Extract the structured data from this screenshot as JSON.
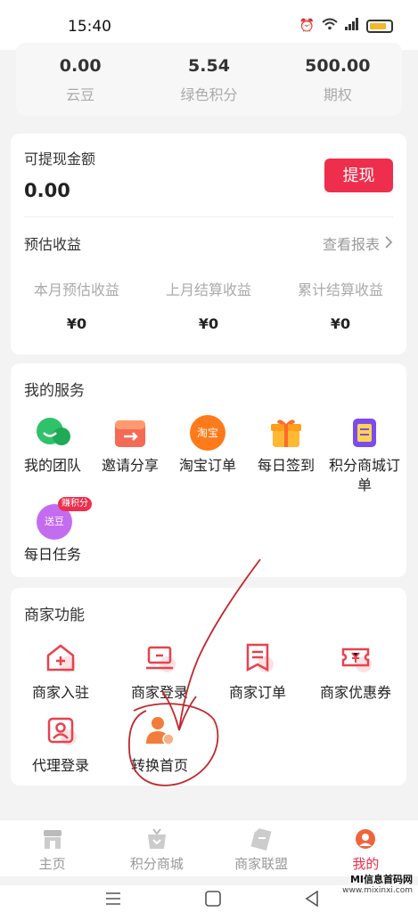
{
  "status": {
    "time": "15:40"
  },
  "top_stats": [
    {
      "value": "0.00",
      "label": "云豆"
    },
    {
      "value": "5.54",
      "label": "绿色积分"
    },
    {
      "value": "500.00",
      "label": "期权"
    }
  ],
  "wallet": {
    "withdraw_label": "可提现金额",
    "withdraw_amount": "0.00",
    "withdraw_button": "提现",
    "estimate_title": "预估收益",
    "report_link": "查看报表",
    "earnings": [
      {
        "label": "本月预估收益",
        "value": "¥0"
      },
      {
        "label": "上月结算收益",
        "value": "¥0"
      },
      {
        "label": "累计结算收益",
        "value": "¥0"
      }
    ]
  },
  "services": {
    "title": "我的服务",
    "items": [
      {
        "label": "我的团队"
      },
      {
        "label": "邀请分享"
      },
      {
        "label": "淘宝订单",
        "icon_text": "淘宝"
      },
      {
        "label": "每日签到"
      },
      {
        "label": "积分商城订单"
      },
      {
        "label": "每日任务",
        "icon_text": "送豆",
        "badge": "赚积分"
      }
    ]
  },
  "merchant": {
    "title": "商家功能",
    "items": [
      {
        "label": "商家入驻"
      },
      {
        "label": "商家登录"
      },
      {
        "label": "商家订单"
      },
      {
        "label": "商家优惠券"
      },
      {
        "label": "代理登录"
      },
      {
        "label": "转换首页"
      }
    ]
  },
  "tabs": [
    {
      "label": "主页"
    },
    {
      "label": "积分商城"
    },
    {
      "label": "商家联盟"
    },
    {
      "label": "我的"
    }
  ],
  "watermark": {
    "title": "MI信息首码网",
    "url": "www.mixinxi.com"
  },
  "colors": {
    "accent": "#ee2e4c",
    "annotation": "#c0282c"
  }
}
